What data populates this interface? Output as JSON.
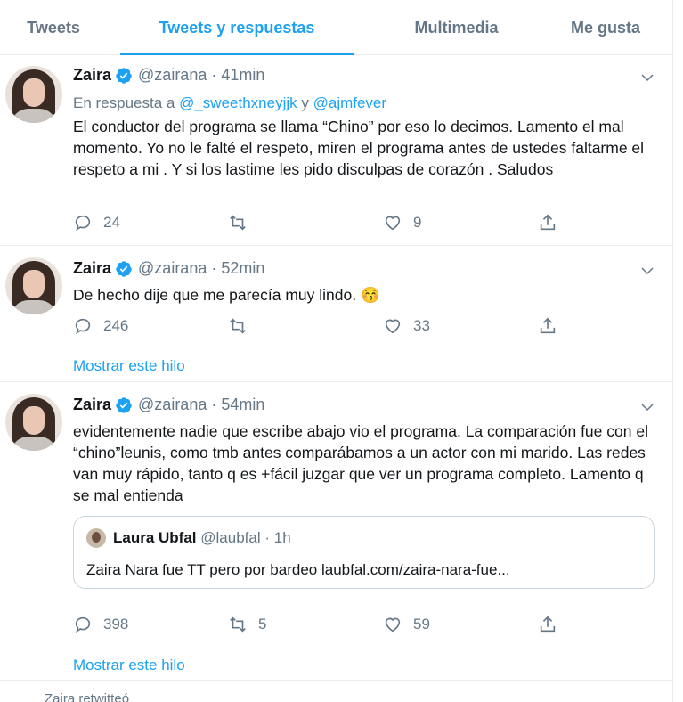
{
  "tabs": [
    {
      "label": "Tweets",
      "active": false
    },
    {
      "label": "Tweets y respuestas",
      "active": true
    },
    {
      "label": "Multimedia",
      "active": false
    },
    {
      "label": "Me gusta",
      "active": false
    }
  ],
  "colors": {
    "accent": "#1da1f2",
    "muted": "#657786",
    "text": "#14171a",
    "border": "#e6ecf0"
  },
  "tweets": [
    {
      "name": "Zaira",
      "handle": "@zairana",
      "dot": "·",
      "time": "41min",
      "reply_prefix": "En respuesta a",
      "reply_user1": "@_sweethxneyjjk",
      "reply_joiner": "y",
      "reply_user2": "@ajmfever",
      "text": "El conductor del programa se llama “Chino” por eso lo decimos. Lamento el mal momento. Yo no le falté el respeto, miren el programa antes de ustedes faltarme el respeto a mi . Y si los lastime les pido disculpas de corazón . Saludos",
      "replies": "24",
      "retweets": "",
      "likes": "9"
    },
    {
      "name": "Zaira",
      "handle": "@zairana",
      "dot": "·",
      "time": "52min",
      "text": "De hecho dije que me parecía muy lindo. 😚",
      "replies": "246",
      "retweets": "",
      "likes": "33",
      "thread": "Mostrar este hilo"
    },
    {
      "name": "Zaira",
      "handle": "@zairana",
      "dot": "·",
      "time": "54min",
      "text": "evidentemente nadie que escribe abajo vio el programa. La comparación fue con el “chino”leunis, como tmb antes comparábamos a un actor con mi marido. Las redes van muy rápido, tanto q es +fácil juzgar que ver un programa completo. Lamento q se mal entienda",
      "quote": {
        "name": "Laura Ubfal",
        "handle": "@laubfal",
        "dot": "·",
        "time": "1h",
        "text": "Zaira Nara fue TT pero por bardeo laubfal.com/zaira-nara-fue..."
      },
      "replies": "398",
      "retweets": "5",
      "likes": "59",
      "thread": "Mostrar este hilo"
    }
  ],
  "icons": {
    "reply": "reply-icon",
    "retweet": "retweet-icon",
    "like": "heart-icon",
    "share": "share-icon",
    "verified": "verified-badge-icon",
    "caret": "chevron-down-icon"
  },
  "footer": {
    "text": "Zaira retwitteó"
  }
}
